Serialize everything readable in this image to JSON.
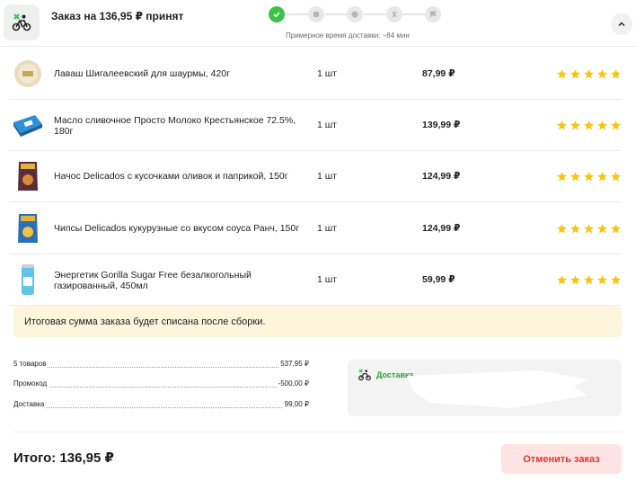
{
  "header": {
    "title": "Заказ на 136,95 ₽ принят",
    "eta": "Примерное время доставки: ~84 мин",
    "steps": [
      "check-icon",
      "chef-icon",
      "clock-icon",
      "courier-icon",
      "flag-icon"
    ],
    "accent": "#3cc24a"
  },
  "items": [
    {
      "name": "Лаваш Шигалеевский для шаурмы, 420г",
      "qty": "1 шт",
      "price": "87,99 ₽",
      "rating": 5
    },
    {
      "name": "Масло сливочное Просто Молоко Крестьянское 72.5%, 180г",
      "qty": "1 шт",
      "price": "139,99 ₽",
      "rating": 5
    },
    {
      "name": "Начос Delicados с кусочками оливок и паприкой, 150г",
      "qty": "1 шт",
      "price": "124,99 ₽",
      "rating": 5
    },
    {
      "name": "Чипсы Delicados кукурузные со вкусом соуса Ранч, 150г",
      "qty": "1 шт",
      "price": "124,99 ₽",
      "rating": 5
    },
    {
      "name": "Энергетик Gorilla Sugar Free безалкогольный газированный, 450мл",
      "qty": "1 шт",
      "price": "59,99 ₽",
      "rating": 5
    }
  ],
  "notice": "Итоговая сумма заказа будет списана после сборки.",
  "summary": [
    {
      "label": "5 товаров",
      "value": "537,95 ₽"
    },
    {
      "label": "Промокод",
      "value": "-500,00 ₽"
    },
    {
      "label": "Доставка",
      "value": "99,00 ₽"
    }
  ],
  "delivery": {
    "label": "Доставка"
  },
  "total": "Итого: 136,95 ₽",
  "cancel_label": "Отменить заказ",
  "colors": {
    "star": "#f6c614",
    "cancel_bg": "#fde3e3",
    "cancel_text": "#e1362f",
    "notice_bg": "#fdf5dc"
  }
}
